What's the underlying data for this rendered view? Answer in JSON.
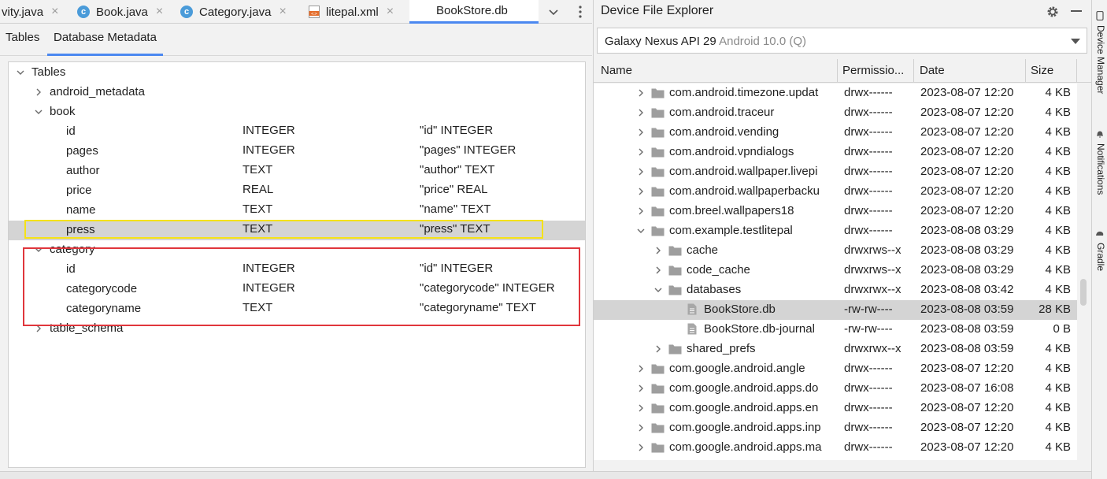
{
  "editor": {
    "tabs": [
      {
        "label": "vity.java",
        "icon": "none"
      },
      {
        "label": "Book.java",
        "icon": "class-c-icon"
      },
      {
        "label": "Category.java",
        "icon": "class-c-icon"
      },
      {
        "label": "litepal.xml",
        "icon": "xml-file-icon"
      },
      {
        "label": "BookStore.db",
        "icon": "none",
        "active": true
      }
    ],
    "close_glyph": "×",
    "subtabs": [
      "Tables",
      "Database Metadata"
    ],
    "tree": {
      "root": "Tables",
      "nodes": [
        {
          "label": "android_metadata"
        },
        {
          "label": "book"
        },
        {
          "label": "category"
        },
        {
          "label": "table_schema"
        }
      ],
      "book_columns": [
        {
          "name": "id",
          "type": "INTEGER",
          "def": "\"id\" INTEGER"
        },
        {
          "name": "pages",
          "type": "INTEGER",
          "def": "\"pages\" INTEGER"
        },
        {
          "name": "author",
          "type": "TEXT",
          "def": "\"author\" TEXT"
        },
        {
          "name": "price",
          "type": "REAL",
          "def": "\"price\" REAL"
        },
        {
          "name": "name",
          "type": "TEXT",
          "def": "\"name\" TEXT"
        },
        {
          "name": "press",
          "type": "TEXT",
          "def": "\"press\" TEXT"
        }
      ],
      "category_columns": [
        {
          "name": "id",
          "type": "INTEGER",
          "def": "\"id\" INTEGER"
        },
        {
          "name": "categorycode",
          "type": "INTEGER",
          "def": "\"categorycode\" INTEGER"
        },
        {
          "name": "categoryname",
          "type": "TEXT",
          "def": "\"categoryname\" TEXT"
        }
      ]
    },
    "highlight_colors": {
      "yellow": "#f5e216",
      "red": "#e0363c"
    }
  },
  "explorer": {
    "title": "Device File Explorer",
    "device": "Galaxy Nexus API 29",
    "os": "Android 10.0 (Q)",
    "columns": [
      "Name",
      "Permissio...",
      "Date",
      "Size"
    ],
    "rows": [
      {
        "name": "com.android.timezone.updat",
        "perm": "drwx------",
        "date": "2023-08-07 12:20",
        "size": "4 KB",
        "kind": "folder",
        "level": 0,
        "state": "collapsed"
      },
      {
        "name": "com.android.traceur",
        "perm": "drwx------",
        "date": "2023-08-07 12:20",
        "size": "4 KB",
        "kind": "folder",
        "level": 0,
        "state": "collapsed"
      },
      {
        "name": "com.android.vending",
        "perm": "drwx------",
        "date": "2023-08-07 12:20",
        "size": "4 KB",
        "kind": "folder",
        "level": 0,
        "state": "collapsed"
      },
      {
        "name": "com.android.vpndialogs",
        "perm": "drwx------",
        "date": "2023-08-07 12:20",
        "size": "4 KB",
        "kind": "folder",
        "level": 0,
        "state": "collapsed"
      },
      {
        "name": "com.android.wallpaper.livepi",
        "perm": "drwx------",
        "date": "2023-08-07 12:20",
        "size": "4 KB",
        "kind": "folder",
        "level": 0,
        "state": "collapsed"
      },
      {
        "name": "com.android.wallpaperbacku",
        "perm": "drwx------",
        "date": "2023-08-07 12:20",
        "size": "4 KB",
        "kind": "folder",
        "level": 0,
        "state": "collapsed"
      },
      {
        "name": "com.breel.wallpapers18",
        "perm": "drwx------",
        "date": "2023-08-07 12:20",
        "size": "4 KB",
        "kind": "folder",
        "level": 0,
        "state": "collapsed"
      },
      {
        "name": "com.example.testlitepal",
        "perm": "drwx------",
        "date": "2023-08-08 03:29",
        "size": "4 KB",
        "kind": "folder",
        "level": 0,
        "state": "expanded"
      },
      {
        "name": "cache",
        "perm": "drwxrws--x",
        "date": "2023-08-08 03:29",
        "size": "4 KB",
        "kind": "folder",
        "level": 1,
        "state": "collapsed"
      },
      {
        "name": "code_cache",
        "perm": "drwxrws--x",
        "date": "2023-08-08 03:29",
        "size": "4 KB",
        "kind": "folder",
        "level": 1,
        "state": "collapsed"
      },
      {
        "name": "databases",
        "perm": "drwxrwx--x",
        "date": "2023-08-08 03:42",
        "size": "4 KB",
        "kind": "folder",
        "level": 1,
        "state": "expanded"
      },
      {
        "name": "BookStore.db",
        "perm": "-rw-rw----",
        "date": "2023-08-08 03:59",
        "size": "28 KB",
        "kind": "file",
        "level": 2,
        "state": "leaf",
        "selected": true
      },
      {
        "name": "BookStore.db-journal",
        "perm": "-rw-rw----",
        "date": "2023-08-08 03:59",
        "size": "0 B",
        "kind": "file",
        "level": 2,
        "state": "leaf"
      },
      {
        "name": "shared_prefs",
        "perm": "drwxrwx--x",
        "date": "2023-08-08 03:59",
        "size": "4 KB",
        "kind": "folder",
        "level": 1,
        "state": "collapsed"
      },
      {
        "name": "com.google.android.angle",
        "perm": "drwx------",
        "date": "2023-08-07 12:20",
        "size": "4 KB",
        "kind": "folder",
        "level": 0,
        "state": "collapsed"
      },
      {
        "name": "com.google.android.apps.do",
        "perm": "drwx------",
        "date": "2023-08-07 16:08",
        "size": "4 KB",
        "kind": "folder",
        "level": 0,
        "state": "collapsed"
      },
      {
        "name": "com.google.android.apps.en",
        "perm": "drwx------",
        "date": "2023-08-07 12:20",
        "size": "4 KB",
        "kind": "folder",
        "level": 0,
        "state": "collapsed"
      },
      {
        "name": "com.google.android.apps.inp",
        "perm": "drwx------",
        "date": "2023-08-07 12:20",
        "size": "4 KB",
        "kind": "folder",
        "level": 0,
        "state": "collapsed"
      },
      {
        "name": "com.google.android.apps.ma",
        "perm": "drwx------",
        "date": "2023-08-07 12:20",
        "size": "4 KB",
        "kind": "folder",
        "level": 0,
        "state": "collapsed"
      }
    ]
  },
  "tool_strip": [
    "Device Manager",
    "Notifications",
    "Gradle"
  ]
}
